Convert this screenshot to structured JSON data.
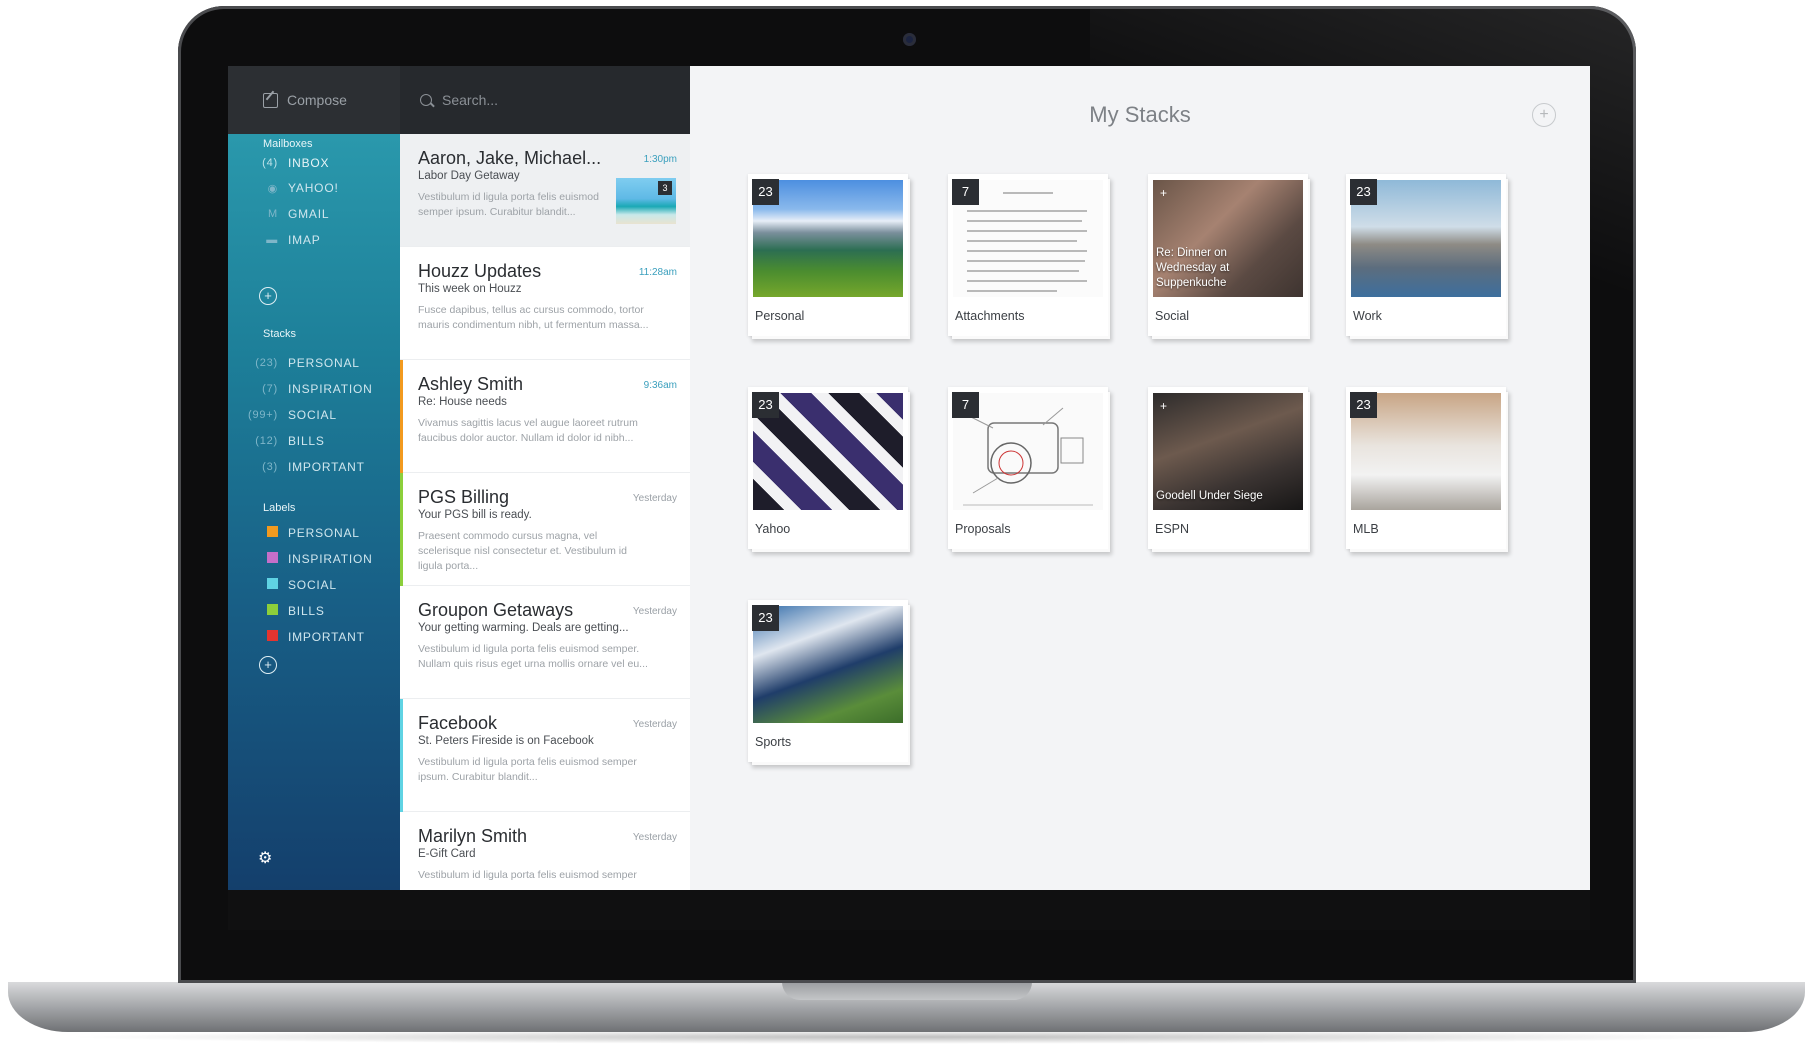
{
  "compose": {
    "label": "Compose"
  },
  "search": {
    "placeholder": "Search..."
  },
  "sidebar": {
    "mailboxes_title": "Mailboxes",
    "mailboxes": [
      {
        "prefix": "(4)",
        "label": "INBOX",
        "icon": "inbox-icon"
      },
      {
        "prefix": "",
        "label": "YAHOO!",
        "icon": "yahoo-icon"
      },
      {
        "prefix": "",
        "label": "GMAIL",
        "icon": "gmail-icon"
      },
      {
        "prefix": "",
        "label": "IMAP",
        "icon": "imap-icon"
      }
    ],
    "stacks_title": "Stacks",
    "stacks": [
      {
        "prefix": "(23)",
        "label": "PERSONAL"
      },
      {
        "prefix": "(7)",
        "label": "INSPIRATION"
      },
      {
        "prefix": "(99+)",
        "label": "SOCIAL"
      },
      {
        "prefix": "(12)",
        "label": "BILLS"
      },
      {
        "prefix": "(3)",
        "label": "IMPORTANT"
      }
    ],
    "labels_title": "Labels",
    "labels": [
      {
        "label": "PERSONAL",
        "color": "#f29a1f"
      },
      {
        "label": "INSPIRATION",
        "color": "#c56fc9"
      },
      {
        "label": "SOCIAL",
        "color": "#5fd3e3"
      },
      {
        "label": "BILLS",
        "color": "#8ccf3b"
      },
      {
        "label": "IMPORTANT",
        "color": "#e3342f"
      }
    ]
  },
  "messages": [
    {
      "from": "Aaron, Jake, Michael...",
      "time": "1:30pm",
      "subject": "Labor Day Getaway",
      "preview": "Vestibulum id ligula porta felis euismod semper ipsum. Curabitur blandit...",
      "attachment_count": "3",
      "accent": ""
    },
    {
      "from": "Houzz Updates",
      "time": "11:28am",
      "subject": "This week on Houzz",
      "preview": "Fusce dapibus, tellus ac cursus commodo, tortor mauris condimentum nibh, ut fermentum massa...",
      "accent": ""
    },
    {
      "from": "Ashley Smith",
      "time": "9:36am",
      "subject": "Re: House needs",
      "preview": "Vivamus sagittis lacus vel augue laoreet rutrum faucibus dolor auctor. Nullam id dolor id nibh...",
      "accent": "#f29a1f"
    },
    {
      "from": "PGS Billing",
      "time": "Yesterday",
      "subject": "Your PGS bill is ready.",
      "preview": "Praesent commodo cursus magna, vel scelerisque nisl consectetur et. Vestibulum id ligula porta...",
      "accent": "#8ccf3b"
    },
    {
      "from": "Groupon Getaways",
      "time": "Yesterday",
      "subject": "Your getting warming. Deals are getting...",
      "preview": "Vestibulum id ligula porta felis euismod semper. Nullam quis risus eget urna mollis ornare vel eu...",
      "accent": ""
    },
    {
      "from": "Facebook",
      "time": "Yesterday",
      "subject": "St. Peters Fireside is on Facebook",
      "preview": "Vestibulum id ligula porta felis euismod semper ipsum. Curabitur blandit...",
      "accent": "#5fd3e3"
    },
    {
      "from": "Marilyn Smith",
      "time": "Yesterday",
      "subject": "E-Gift Card",
      "preview": "Vestibulum id ligula porta felis euismod semper",
      "accent": ""
    }
  ],
  "stacks_view": {
    "title": "My Stacks",
    "cards": [
      {
        "caption": "Personal",
        "count": "23",
        "overlay": ""
      },
      {
        "caption": "Attachments",
        "count": "7",
        "overlay": ""
      },
      {
        "caption": "Social",
        "count": "",
        "overlay": "Re: Dinner on Wednesday at Suppenkuche"
      },
      {
        "caption": "Work",
        "count": "23",
        "overlay": ""
      },
      {
        "caption": "Yahoo",
        "count": "23",
        "overlay": ""
      },
      {
        "caption": "Proposals",
        "count": "7",
        "overlay": ""
      },
      {
        "caption": "ESPN",
        "count": "",
        "overlay": "Goodell Under Siege"
      },
      {
        "caption": "MLB",
        "count": "23",
        "overlay": ""
      },
      {
        "caption": "Sports",
        "count": "23",
        "overlay": ""
      }
    ]
  }
}
